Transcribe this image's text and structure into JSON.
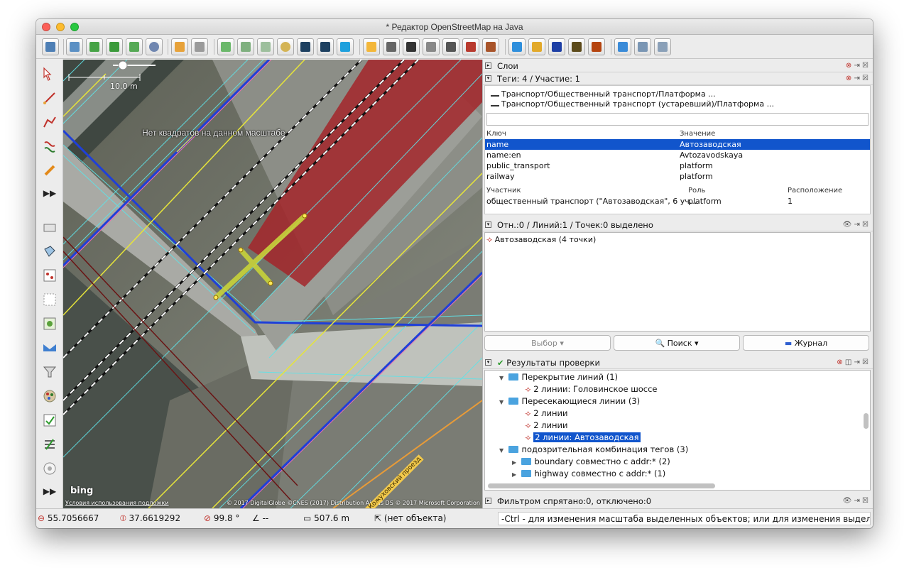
{
  "window": {
    "title": "* Редактор OpenStreetMap на Java"
  },
  "map": {
    "scale_label": "10.0 m",
    "notice": "Нет квадратов на данном масштабе",
    "terms_link": "Условия использования подложки",
    "attribution": "© 2017 DigitalGlobe ©CNES (2017) Distribution Airbus DS © 2017 Microsoft Corporation",
    "bing_logo": "bing",
    "street_label": "1-й Кожуховский проезд"
  },
  "layers_panel": {
    "title": "Слои"
  },
  "tags_panel": {
    "title": "Теги: 4 / Участие: 1",
    "presets": [
      "Транспорт/Общественный транспорт/Платформа ...",
      "Транспорт/Общественный транспорт (устаревший)/Платформа ..."
    ],
    "key_header": "Ключ",
    "value_header": "Значение",
    "tags": [
      {
        "key": "name",
        "value": "Автозаводская"
      },
      {
        "key": "name:en",
        "value": "Avtozavodskaya"
      },
      {
        "key": "public_transport",
        "value": "platform"
      },
      {
        "key": "railway",
        "value": "platform"
      }
    ],
    "member_header": "Участник",
    "role_header": "Роль",
    "position_header": "Расположение",
    "members": [
      {
        "member": "общественный транспорт (\"Автозаводская\", 6 уч...",
        "role": "platform",
        "position": "1"
      }
    ]
  },
  "selection_panel": {
    "title": "Отн.:0 / Линий:1 / Точек:0 выделено",
    "items": [
      "Автозаводская (4 точки)"
    ],
    "select_button": "Выбор",
    "search_button": "Поиск",
    "history_button": "Журнал"
  },
  "validation_panel": {
    "title": "Результаты проверки",
    "rows": [
      {
        "level": 1,
        "type": "folder",
        "expand": "▼",
        "text": "Перекрытие линий (1)"
      },
      {
        "level": 2,
        "type": "way",
        "text": "2 линии: Головинское шоссе"
      },
      {
        "level": 1,
        "type": "folder",
        "expand": "▼",
        "text": "Пересекающиеся линии (3)"
      },
      {
        "level": 2,
        "type": "way",
        "text": "2 линии"
      },
      {
        "level": 2,
        "type": "way",
        "text": "2 линии"
      },
      {
        "level": 2,
        "type": "way",
        "text": "2 линии: Автозаводская",
        "selected": true
      },
      {
        "level": 1,
        "type": "folder",
        "expand": "▼",
        "text": "подозрительная комбинация тегов (3)"
      },
      {
        "level": 2,
        "type": "folder",
        "expand": "▶",
        "text": "boundary совместно с addr:* (2)"
      },
      {
        "level": 2,
        "type": "folder",
        "expand": "▶",
        "text": "highway совместно с addr:* (1)"
      }
    ]
  },
  "filter_panel": {
    "title": "Фильтром спрятано:0, отключено:0"
  },
  "status": {
    "lat": "55.7056667",
    "lon": "37.6619292",
    "heading": "99.8 °",
    "angle": "--",
    "distance": "507.6 m",
    "object": "(нет объекта)",
    "hint": "-Ctrl - для изменения масштаба выделенных объектов; или для изменения выделения"
  },
  "colors": {
    "selection": "#1155cc",
    "road_blue": "#1f3fd8",
    "rail_white": "#ffffff",
    "platform_red": "#a3262a",
    "highlight": "#c8d33a"
  }
}
